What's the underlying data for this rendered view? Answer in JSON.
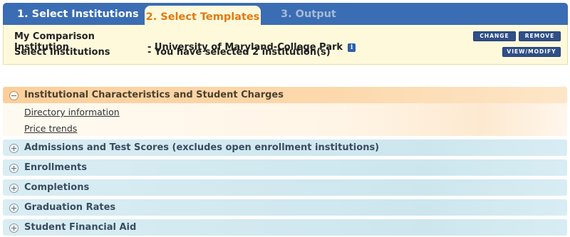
{
  "tabs": [
    {
      "label": "1. Select Institutions"
    },
    {
      "label": "2. Select Templates"
    },
    {
      "label": "3. Output"
    }
  ],
  "info": {
    "comparison_label": "My Comparison Institution",
    "comparison_value": "- University of Maryland-College Park",
    "select_label": "Select Institutions",
    "select_value": "- You have selected 2 institution(s)",
    "info_icon_glyph": "i",
    "change_button": "CHANGE",
    "remove_button": "REMOVE",
    "view_modify_button": "VIEW/MODIFY"
  },
  "sections": [
    {
      "title": "Institutional Characteristics and Student Charges",
      "expanded": true,
      "items": [
        "Directory information",
        "Price trends"
      ]
    },
    {
      "title": "Admissions and Test Scores (excludes open enrollment institutions)",
      "expanded": false
    },
    {
      "title": "Enrollments",
      "expanded": false
    },
    {
      "title": "Completions",
      "expanded": false
    },
    {
      "title": "Graduation Rates",
      "expanded": false
    },
    {
      "title": "Student Financial Aid",
      "expanded": false
    }
  ],
  "colors": {
    "tab_bar": "#3a6db3",
    "active_tab_text": "#e07a12",
    "info_background": "#fff9dc",
    "button": "#2f4f88",
    "section_open": "#fbcf9a",
    "section_collapsed": "#d9edf3"
  }
}
